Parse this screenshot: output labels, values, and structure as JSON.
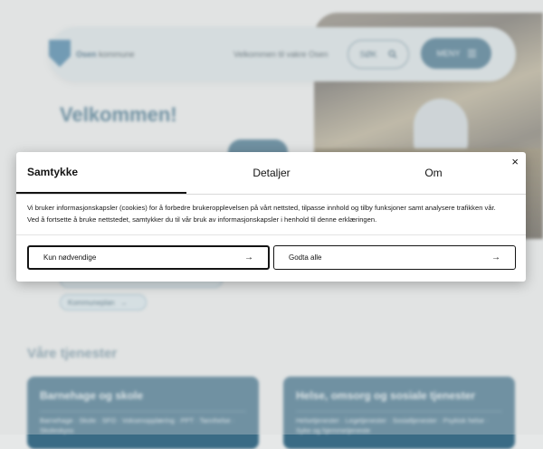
{
  "site": {
    "logo_text_bold": "Osen",
    "logo_text": " kommune",
    "welcome_link": "Velkommen til vakre Osen",
    "search_label": "SØK",
    "menu_label": "MENY",
    "hero_title": "Velkommen!",
    "chip_kommuneplan": "Kommuneplan",
    "services_title": "Våre tjenester",
    "cards": [
      {
        "title": "Barnehage og skole",
        "text": "Barnehage · Skole · SFO · Voksenopplæring · PPT · Tannhelse · Skoleskyss"
      },
      {
        "title": "Helse, omsorg og sosiale tjenester",
        "text": "Helsetjenester · Legetjenester · Sosialtjenester · Psykisk helse · Syke og hjemmetjeneste"
      }
    ]
  },
  "consent": {
    "tabs": [
      "Samtykke",
      "Detaljer",
      "Om"
    ],
    "close_label": "×",
    "body_line1": "Vi bruker informasjonskapsler (cookies) for å forbedre brukeropplevelsen på vårt nettsted, tilpasse innhold og tilby funksjoner samt analysere trafikken vår.",
    "body_line2": "Ved å fortsette å bruke nettstedet, samtykker du til vår bruk av informasjonskapsler i henhold til denne erklæringen.",
    "btn_necessary": "Kun nødvendige",
    "btn_accept": "Godta alle",
    "arrow": "→"
  }
}
